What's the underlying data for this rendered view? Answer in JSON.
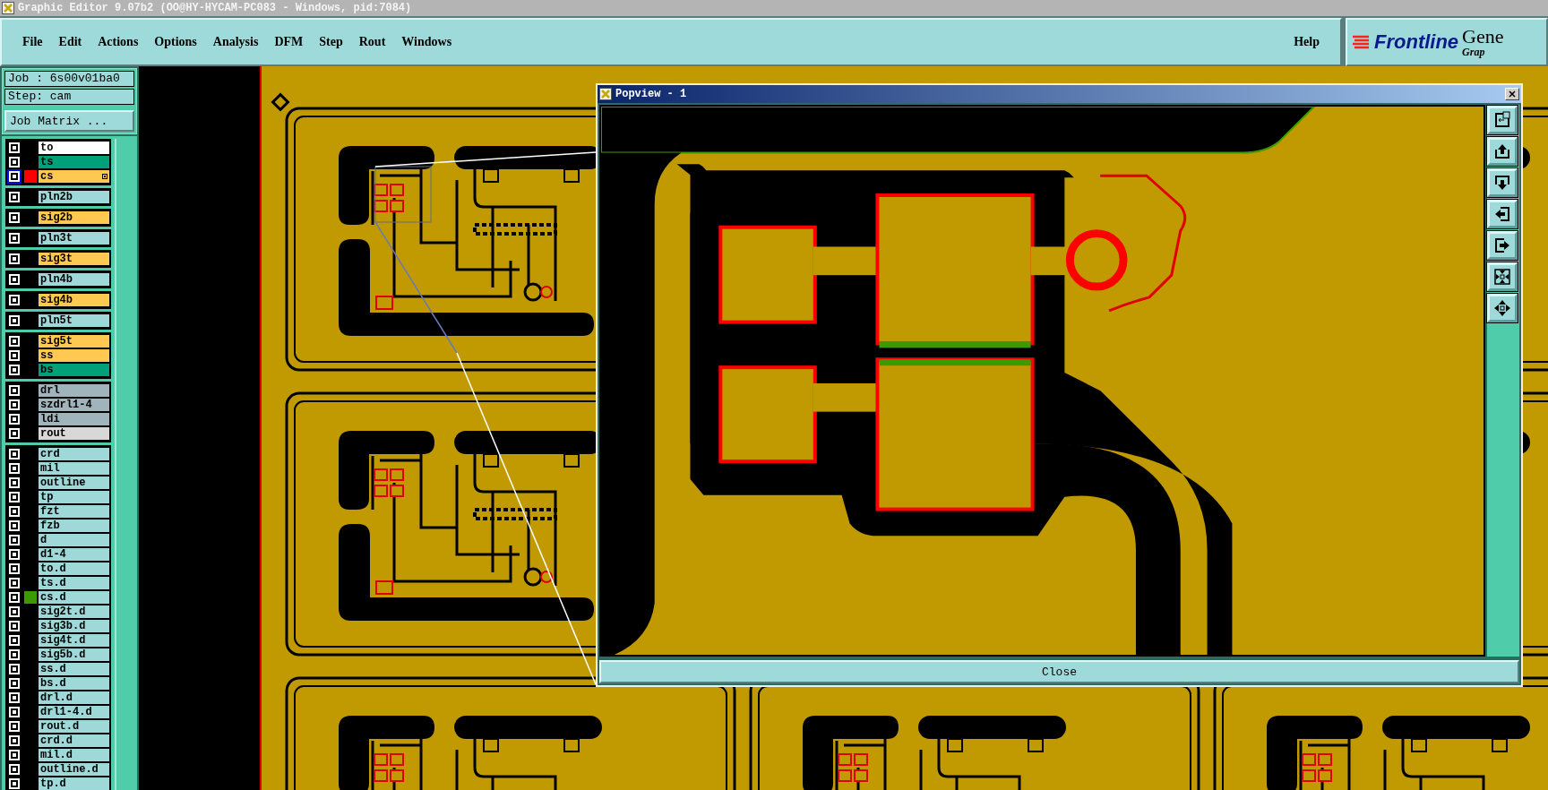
{
  "title_bar": {
    "title": "Graphic Editor 9.07b2 (OO@HY-HYCAM-PC083 - Windows, pid:7084)"
  },
  "menu": [
    "File",
    "Edit",
    "Actions",
    "Options",
    "Analysis",
    "DFM",
    "Step",
    "Rout",
    "Windows"
  ],
  "help": "Help",
  "logo": {
    "brand": "Frontline",
    "product": "Gene",
    "subtitle": "Grap"
  },
  "job": {
    "job": "Job : 6s00v01ba0",
    "step": "Step: cam",
    "matrix_button": "Job Matrix ..."
  },
  "layer_groups": [
    {
      "layers": [
        {
          "name": "to",
          "color": "#ffffff",
          "work": false
        },
        {
          "name": "ts",
          "color": "#00a078",
          "work": false
        },
        {
          "name": "cs",
          "color": "#ffc850",
          "work": true,
          "marker": {
            "color": "#ff0000"
          }
        }
      ]
    },
    {
      "layers": [
        {
          "name": "pln2b",
          "color": "#9ed8d8",
          "work": false
        }
      ]
    },
    {
      "layers": [
        {
          "name": "sig2b",
          "color": "#ffc850",
          "work": false
        }
      ]
    },
    {
      "layers": [
        {
          "name": "pln3t",
          "color": "#9ed8d8",
          "work": false
        }
      ]
    },
    {
      "layers": [
        {
          "name": "sig3t",
          "color": "#ffc850",
          "work": false
        }
      ]
    },
    {
      "layers": [
        {
          "name": "pln4b",
          "color": "#9ed8d8",
          "work": false
        }
      ]
    },
    {
      "layers": [
        {
          "name": "sig4b",
          "color": "#ffc850",
          "work": false
        }
      ]
    },
    {
      "layers": [
        {
          "name": "pln5t",
          "color": "#9ed8d8",
          "work": false
        }
      ]
    },
    {
      "layers": [
        {
          "name": "sig5t",
          "color": "#ffc850",
          "work": false
        },
        {
          "name": "ss",
          "color": "#ffc850",
          "work": false
        },
        {
          "name": "bs",
          "color": "#00a078",
          "work": false
        }
      ]
    },
    {
      "layers": [
        {
          "name": "drl",
          "color": "#a0b4bc",
          "work": false
        },
        {
          "name": "szdrl1-4",
          "color": "#a0b4bc",
          "work": false
        },
        {
          "name": "ldi",
          "color": "#a0b4bc",
          "work": false
        },
        {
          "name": "rout",
          "color": "#d8d8d8",
          "work": false
        }
      ]
    },
    {
      "layers": [
        {
          "name": "crd",
          "color": "#9ed8d8",
          "work": false
        },
        {
          "name": "mil",
          "color": "#9ed8d8",
          "work": false
        },
        {
          "name": "outline",
          "color": "#9ed8d8",
          "work": false
        },
        {
          "name": "tp",
          "color": "#9ed8d8",
          "work": false
        },
        {
          "name": "fzt",
          "color": "#9ed8d8",
          "work": false
        },
        {
          "name": "fzb",
          "color": "#9ed8d8",
          "work": false
        },
        {
          "name": "d",
          "color": "#9ed8d8",
          "work": false
        },
        {
          "name": "d1-4",
          "color": "#9ed8d8",
          "work": false
        },
        {
          "name": "to.d",
          "color": "#9ed8d8",
          "work": false
        },
        {
          "name": "ts.d",
          "color": "#9ed8d8",
          "work": false
        },
        {
          "name": "cs.d",
          "color": "#9ed8d8",
          "work": false,
          "marker": {
            "color": "#3c9a00"
          }
        },
        {
          "name": "sig2t.d",
          "color": "#9ed8d8",
          "work": false
        },
        {
          "name": "sig3b.d",
          "color": "#9ed8d8",
          "work": false
        },
        {
          "name": "sig4t.d",
          "color": "#9ed8d8",
          "work": false
        },
        {
          "name": "sig5b.d",
          "color": "#9ed8d8",
          "work": false
        },
        {
          "name": "ss.d",
          "color": "#9ed8d8",
          "work": false
        },
        {
          "name": "bs.d",
          "color": "#9ed8d8",
          "work": false
        },
        {
          "name": "drl.d",
          "color": "#9ed8d8",
          "work": false
        },
        {
          "name": "drl1-4.d",
          "color": "#9ed8d8",
          "work": false
        },
        {
          "name": "rout.d",
          "color": "#9ed8d8",
          "work": false
        },
        {
          "name": "crd.d",
          "color": "#9ed8d8",
          "work": false
        },
        {
          "name": "mil.d",
          "color": "#9ed8d8",
          "work": false
        },
        {
          "name": "outline.d",
          "color": "#9ed8d8",
          "work": false
        },
        {
          "name": "tp.d",
          "color": "#9ed8d8",
          "work": false
        }
      ]
    }
  ],
  "popview": {
    "title": "Popview - 1",
    "close_button": "Close"
  }
}
